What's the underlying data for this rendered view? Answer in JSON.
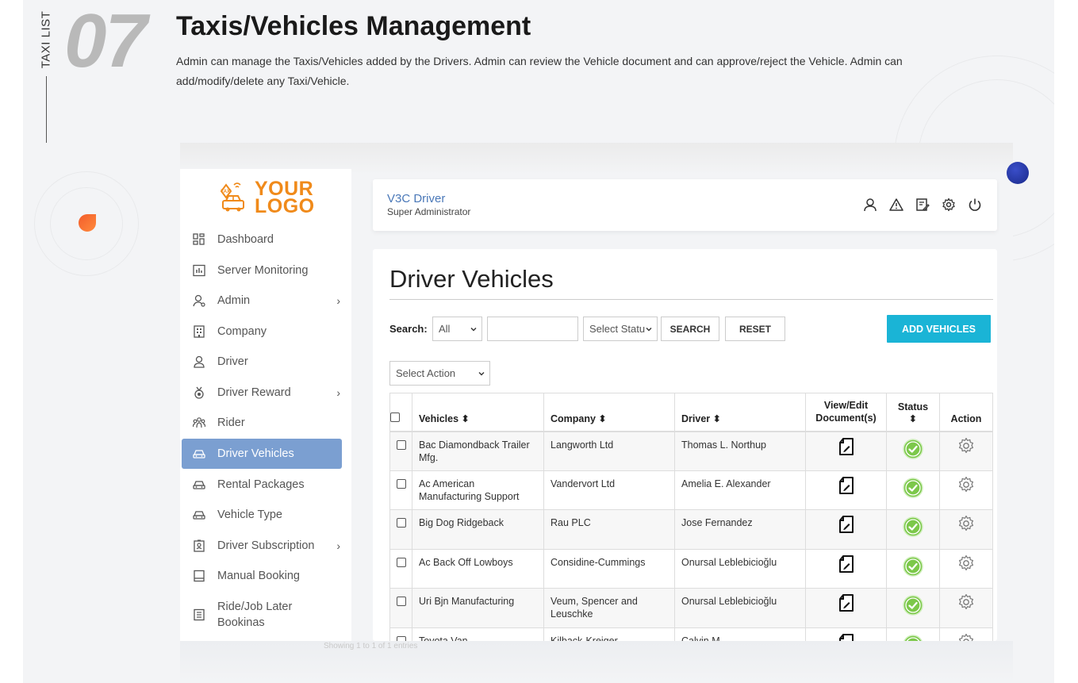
{
  "section": {
    "vertical_label": "TAXI LIST",
    "number": "07",
    "title": "Taxis/Vehicles Management",
    "description": "Admin can manage the Taxis/Vehicles added by the Drivers. Admin can review the Vehicle document and can approve/reject the Vehicle. Admin can add/modify/delete any Taxi/Vehicle."
  },
  "logo": {
    "line1": "YOUR",
    "line2": "LOGO",
    "badge": "TAXI"
  },
  "sidebar": {
    "items": [
      {
        "label": "Dashboard",
        "icon": "dashboard-icon"
      },
      {
        "label": "Server Monitoring",
        "icon": "chart-icon"
      },
      {
        "label": "Admin",
        "icon": "admin-user-icon",
        "has_children": true
      },
      {
        "label": "Company",
        "icon": "building-icon"
      },
      {
        "label": "Driver",
        "icon": "driver-icon"
      },
      {
        "label": "Driver Reward",
        "icon": "medal-icon",
        "has_children": true
      },
      {
        "label": "Rider",
        "icon": "riders-icon"
      },
      {
        "label": "Driver Vehicles",
        "icon": "car-icon",
        "active": true
      },
      {
        "label": "Rental Packages",
        "icon": "car-icon"
      },
      {
        "label": "Vehicle Type",
        "icon": "car-icon"
      },
      {
        "label": "Driver Subscription",
        "icon": "subscription-icon",
        "has_children": true
      },
      {
        "label": "Manual Booking",
        "icon": "booking-icon"
      },
      {
        "label": "Ride/Job Later Bookinas",
        "line1": "Ride/Job Later",
        "line2": "Bookinas",
        "icon": "list-icon"
      }
    ]
  },
  "header": {
    "brand": "V3C Driver",
    "role": "Super Administrator",
    "icons": [
      "profile-icon",
      "alert-icon",
      "edit-icon",
      "settings-icon",
      "power-icon"
    ]
  },
  "page": {
    "title": "Driver Vehicles",
    "search_label": "Search:",
    "filter_value": "All",
    "search_value": "",
    "status_value": "Select Statu",
    "search_button": "SEARCH",
    "reset_button": "RESET",
    "add_button": "ADD VEHICLES",
    "action_select": "Select Action"
  },
  "table": {
    "columns": {
      "vehicles": "Vehicles ⬍",
      "company": "Company ⬍",
      "driver": "Driver ⬍",
      "docs_line1": "View/Edit",
      "docs_line2": "Document(s)",
      "status": "Status ⬍",
      "action": "Action"
    },
    "rows": [
      {
        "vehicle": "Bac Diamondback Trailer Mfg.",
        "company": "Langworth Ltd",
        "driver": "Thomas L. Northup",
        "status": "active"
      },
      {
        "vehicle": "Ac American Manufacturing Support",
        "company": "Vandervort Ltd",
        "driver": "Amelia E. Alexander",
        "status": "active"
      },
      {
        "vehicle": "Big Dog Ridgeback",
        "company": "Rau PLC",
        "driver": "Jose Fernandez",
        "status": "active"
      },
      {
        "vehicle": "Ac Back Off Lowboys",
        "company": "Considine-Cummings",
        "driver": "Onursal Leblebicioğlu",
        "status": "active"
      },
      {
        "vehicle": "Uri Bjn Manufacturing",
        "company": "Veum, Spencer and Leuschke",
        "driver": "Onursal Leblebicioğlu",
        "status": "active"
      },
      {
        "vehicle": "Toyota Van",
        "company": "Kilback-Kreiger",
        "driver": "Calvin M",
        "status": "active"
      }
    ]
  },
  "footer_ghost": "Showing 1 to 1 of 1 entries",
  "colors": {
    "active_nav": "#7b9fd1",
    "add_button": "#1ab4d6",
    "brand": "#4a78b8",
    "logo": "#f08a1a",
    "status_ok": "#7cc84a"
  }
}
